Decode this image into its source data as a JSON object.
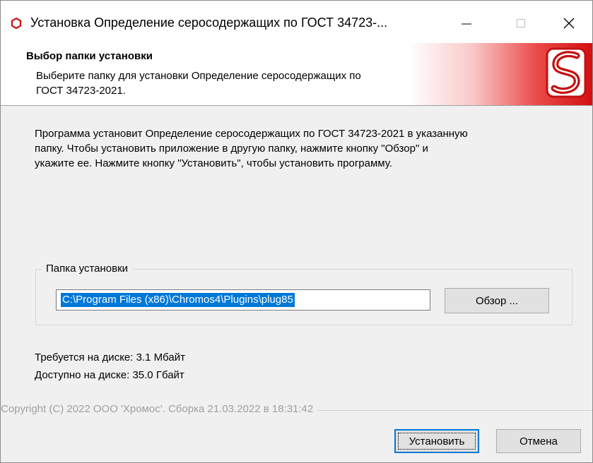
{
  "window": {
    "title": "Установка Определение серосодержащих по ГОСТ 34723-..."
  },
  "header": {
    "title": "Выбор папки установки",
    "subtitle": "Выберите папку для установки Определение серосодержащих по ГОСТ 34723-2021."
  },
  "body": {
    "intro": "Программа установит Определение серосодержащих по ГОСТ 34723-2021 в указанную\nпапку. Чтобы установить приложение в другую папку, нажмите кнопку \"Обзор\" и\nукажите ее. Нажмите кнопку \"Установить\", чтобы установить программу.",
    "group_label": "Папка установки",
    "path_value": "C:\\Program Files (x86)\\Chromos4\\Plugins\\plug85",
    "browse_label": "Обзор ...",
    "disk_required": "Требуется на диске: 3.1 Мбайт",
    "disk_available": "Доступно на диске: 35.0 Гбайт"
  },
  "footer": {
    "copyright": "Copyright (C) 2022 ООО 'Хромос'. Сборка 21.03.2022 в 18:31:42",
    "install_label": "Установить",
    "cancel_label": "Отмена"
  },
  "colors": {
    "accent": "#0078d7",
    "brand_red": "#d40f10"
  },
  "icons": [
    "app-icon",
    "minimize-icon",
    "maximize-icon",
    "close-icon",
    "brand-logo"
  ]
}
